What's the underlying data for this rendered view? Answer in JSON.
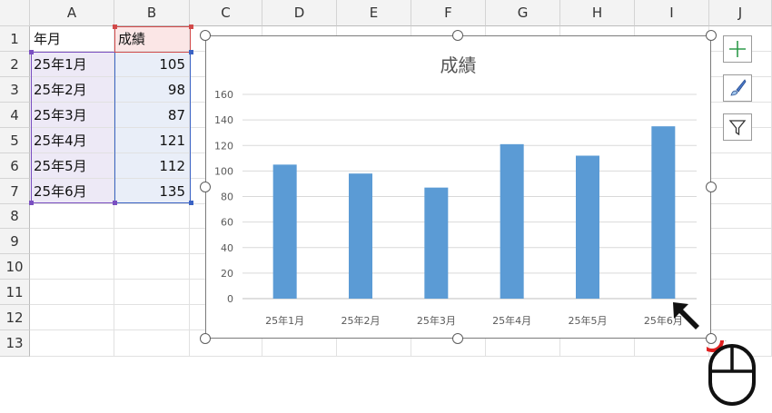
{
  "columns": [
    "A",
    "B",
    "C",
    "D",
    "E",
    "F",
    "G",
    "H",
    "I",
    "J"
  ],
  "rows": [
    "1",
    "2",
    "3",
    "4",
    "5",
    "6",
    "7",
    "8",
    "9",
    "10",
    "11",
    "12",
    "13"
  ],
  "cells": [
    {
      "a": "年月",
      "b": "成績"
    },
    {
      "a": "25年1月",
      "b": "105"
    },
    {
      "a": "25年2月",
      "b": "98"
    },
    {
      "a": "25年3月",
      "b": "87"
    },
    {
      "a": "25年4月",
      "b": "121"
    },
    {
      "a": "25年5月",
      "b": "112"
    },
    {
      "a": "25年6月",
      "b": "135"
    }
  ],
  "chart_data": {
    "type": "bar",
    "title": "成績",
    "categories": [
      "25年1月",
      "25年2月",
      "25年3月",
      "25年4月",
      "25年5月",
      "25年6月"
    ],
    "values": [
      105,
      98,
      87,
      121,
      112,
      135
    ],
    "ylim": [
      0,
      160
    ],
    "yticks": [
      "0",
      "20",
      "40",
      "60",
      "80",
      "100",
      "120",
      "140",
      "160"
    ],
    "grid": true,
    "legend": "none",
    "bar_color": "#5b9bd5",
    "xlabel": "",
    "ylabel": ""
  },
  "chart_tools": [
    {
      "name": "chart-elements-button",
      "icon": "plus-icon"
    },
    {
      "name": "chart-styles-button",
      "icon": "paintbrush-icon"
    },
    {
      "name": "chart-filters-button",
      "icon": "filter-icon"
    }
  ],
  "colors": {
    "header_bg": "#f3f3f3",
    "selection_a": "#7a4fc1",
    "selection_b": "#3b63c4",
    "selection_header": "#d24a4a",
    "cursor_highlight": "#e02020"
  }
}
